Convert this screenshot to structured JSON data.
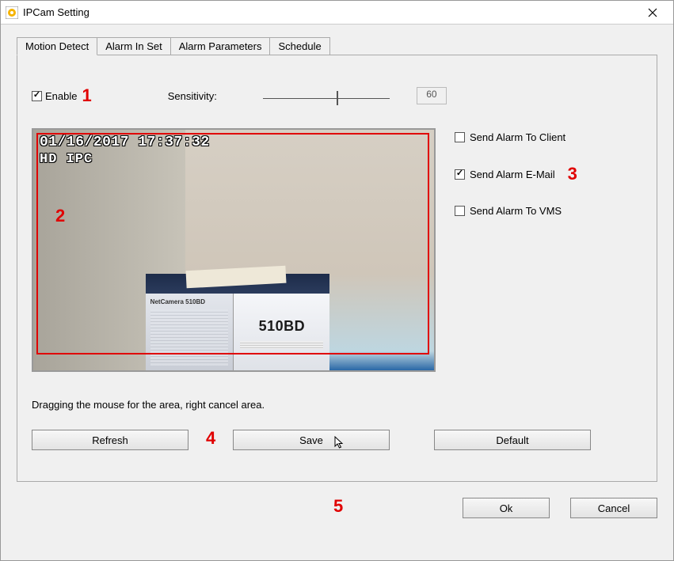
{
  "window": {
    "title": "IPCam Setting"
  },
  "tabs": [
    {
      "label": "Motion Detect"
    },
    {
      "label": "Alarm In Set"
    },
    {
      "label": "Alarm Parameters"
    },
    {
      "label": "Schedule"
    }
  ],
  "motion": {
    "enable_label": "Enable",
    "enable_checked": true,
    "sensitivity_label": "Sensitivity:",
    "sensitivity_value": "60"
  },
  "video": {
    "timestamp": "01/16/2017 17:37:32",
    "camera_name": "HD IPC",
    "device_model": "510BD",
    "device_brand": "NetCamera 510BD"
  },
  "alarms": {
    "to_client_label": "Send Alarm To Client",
    "to_client_checked": false,
    "email_label": "Send Alarm E-Mail",
    "email_checked": true,
    "vms_label": "Send Alarm To VMS",
    "vms_checked": false
  },
  "help_text": "Dragging the mouse for the area, right cancel area.",
  "buttons": {
    "refresh": "Refresh",
    "save": "Save",
    "default": "Default",
    "ok": "Ok",
    "cancel": "Cancel"
  },
  "annotations": {
    "a1": "1",
    "a2": "2",
    "a3": "3",
    "a4": "4",
    "a5": "5"
  }
}
